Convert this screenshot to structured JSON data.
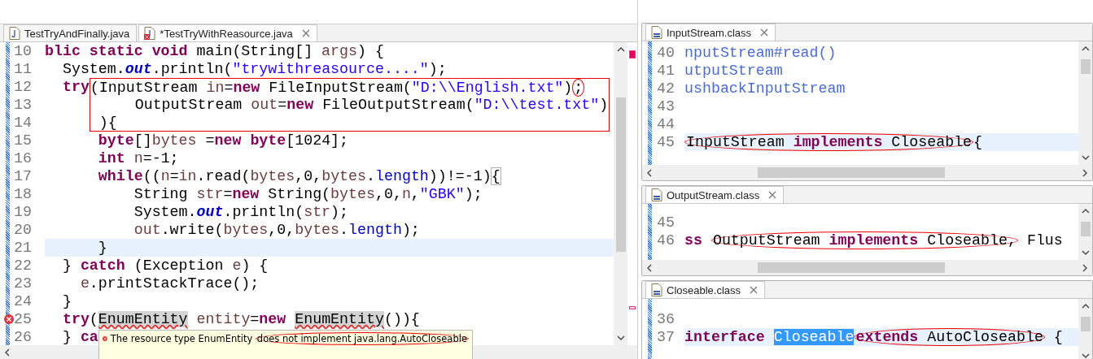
{
  "editor": {
    "tabs": [
      {
        "label": "TestTryAndFinally.java",
        "kind": "java",
        "selected": false,
        "error": false
      },
      {
        "label": "*TestTryWithReasource.java",
        "kind": "java",
        "selected": true,
        "error": true
      }
    ],
    "lines": [
      {
        "number": "10",
        "current": false,
        "error": false,
        "tokens": [
          {
            "text": "blic static void",
            "kind": "keyword"
          },
          {
            "text": " main(String[] ",
            "kind": "plain"
          },
          {
            "text": "args",
            "kind": "local"
          },
          {
            "text": ") {",
            "kind": "plain"
          }
        ]
      },
      {
        "number": "11",
        "current": false,
        "error": false,
        "tokens": [
          {
            "text": "  System.",
            "kind": "plain"
          },
          {
            "text": "out",
            "kind": "static-field"
          },
          {
            "text": ".println(",
            "kind": "plain"
          },
          {
            "text": "\"trywithreasource....\"",
            "kind": "string"
          },
          {
            "text": ");",
            "kind": "plain"
          }
        ]
      },
      {
        "number": "12",
        "current": false,
        "error": false,
        "tokens": [
          {
            "text": "  try",
            "kind": "keyword"
          },
          {
            "kind": "box",
            "top": true,
            "bottom": false,
            "tokens": [
              {
                "text": "(InputStream ",
                "kind": "plain"
              },
              {
                "text": "in",
                "kind": "local"
              },
              {
                "text": "=",
                "kind": "plain"
              },
              {
                "text": "new",
                "kind": "keyword"
              },
              {
                "text": " FileInputStream(",
                "kind": "plain"
              },
              {
                "text": "\"D:\\\\English.txt\"",
                "kind": "string"
              },
              {
                "text": ")",
                "kind": "plain"
              },
              {
                "kind": "circled",
                "tokens": [
                  {
                    "text": ";",
                    "kind": "plain"
                  }
                ]
              }
            ]
          }
        ]
      },
      {
        "number": "13",
        "current": false,
        "error": false,
        "tokens": [
          {
            "kind": "box",
            "top": false,
            "bottom": false,
            "tokens": [
              {
                "text": "     OutputStream ",
                "kind": "plain"
              },
              {
                "text": "out",
                "kind": "local"
              },
              {
                "text": "=",
                "kind": "plain"
              },
              {
                "text": "new",
                "kind": "keyword"
              },
              {
                "text": " FileOutputStream(",
                "kind": "plain"
              },
              {
                "text": "\"D:\\\\test.txt\"",
                "kind": "string"
              },
              {
                "text": ")",
                "kind": "plain"
              }
            ]
          }
        ]
      },
      {
        "number": "14",
        "current": false,
        "error": false,
        "tokens": [
          {
            "kind": "box",
            "top": false,
            "bottom": true,
            "tokens": [
              {
                "text": " ){",
                "kind": "plain"
              }
            ]
          }
        ]
      },
      {
        "number": "15",
        "current": false,
        "error": false,
        "tokens": [
          {
            "text": "      byte",
            "kind": "keyword"
          },
          {
            "text": "[]",
            "kind": "plain"
          },
          {
            "text": "bytes",
            "kind": "local"
          },
          {
            "text": " =",
            "kind": "plain"
          },
          {
            "text": "new",
            "kind": "keyword"
          },
          {
            "text": " byte",
            "kind": "keyword"
          },
          {
            "text": "[1024];",
            "kind": "plain"
          }
        ]
      },
      {
        "number": "16",
        "current": false,
        "error": false,
        "tokens": [
          {
            "text": "      int",
            "kind": "keyword"
          },
          {
            "text": " n",
            "kind": "local"
          },
          {
            "text": "=-1;",
            "kind": "plain"
          }
        ]
      },
      {
        "number": "17",
        "current": false,
        "error": false,
        "tokens": [
          {
            "text": "      while",
            "kind": "keyword"
          },
          {
            "text": "((",
            "kind": "plain"
          },
          {
            "text": "n",
            "kind": "local"
          },
          {
            "text": "=",
            "kind": "plain"
          },
          {
            "text": "in",
            "kind": "local"
          },
          {
            "text": ".read(",
            "kind": "plain"
          },
          {
            "text": "bytes",
            "kind": "local"
          },
          {
            "text": ",0,",
            "kind": "plain"
          },
          {
            "text": "bytes",
            "kind": "local"
          },
          {
            "text": ".",
            "kind": "plain"
          },
          {
            "text": "length",
            "kind": "field"
          },
          {
            "text": "))!=-1)",
            "kind": "plain"
          },
          {
            "kind": "bracket",
            "tokens": [
              {
                "text": "{",
                "kind": "plain"
              }
            ]
          }
        ]
      },
      {
        "number": "18",
        "current": false,
        "error": false,
        "tokens": [
          {
            "text": "          String ",
            "kind": "plain"
          },
          {
            "text": "str",
            "kind": "local"
          },
          {
            "text": "=",
            "kind": "plain"
          },
          {
            "text": "new",
            "kind": "keyword"
          },
          {
            "text": " String(",
            "kind": "plain"
          },
          {
            "text": "bytes",
            "kind": "local"
          },
          {
            "text": ",0,",
            "kind": "plain"
          },
          {
            "text": "n",
            "kind": "local"
          },
          {
            "text": ",",
            "kind": "plain"
          },
          {
            "text": "\"GBK\"",
            "kind": "string"
          },
          {
            "text": ");",
            "kind": "plain"
          }
        ]
      },
      {
        "number": "19",
        "current": false,
        "error": false,
        "tokens": [
          {
            "text": "          System.",
            "kind": "plain"
          },
          {
            "text": "out",
            "kind": "static-field"
          },
          {
            "text": ".println(",
            "kind": "plain"
          },
          {
            "text": "str",
            "kind": "local"
          },
          {
            "text": ");",
            "kind": "plain"
          }
        ]
      },
      {
        "number": "20",
        "current": false,
        "error": false,
        "tokens": [
          {
            "text": "          out",
            "kind": "local"
          },
          {
            "text": ".write(",
            "kind": "plain"
          },
          {
            "text": "bytes",
            "kind": "local"
          },
          {
            "text": ",0,",
            "kind": "plain"
          },
          {
            "text": "bytes",
            "kind": "local"
          },
          {
            "text": ".",
            "kind": "plain"
          },
          {
            "text": "length",
            "kind": "field"
          },
          {
            "text": ");",
            "kind": "plain"
          }
        ]
      },
      {
        "number": "21",
        "current": true,
        "error": false,
        "tokens": [
          {
            "text": "      }",
            "kind": "plain"
          }
        ]
      },
      {
        "number": "22",
        "current": false,
        "error": false,
        "tokens": [
          {
            "text": "  } ",
            "kind": "plain"
          },
          {
            "text": "catch",
            "kind": "keyword"
          },
          {
            "text": " (Exception ",
            "kind": "plain"
          },
          {
            "text": "e",
            "kind": "local"
          },
          {
            "text": ") {",
            "kind": "plain"
          }
        ]
      },
      {
        "number": "23",
        "current": false,
        "error": false,
        "tokens": [
          {
            "text": "    e",
            "kind": "local"
          },
          {
            "text": ".printStackTrace();",
            "kind": "plain"
          }
        ]
      },
      {
        "number": "24",
        "current": false,
        "error": false,
        "tokens": [
          {
            "text": "  }",
            "kind": "plain"
          }
        ]
      },
      {
        "number": "25",
        "current": false,
        "error": true,
        "tokens": [
          {
            "text": "  try",
            "kind": "keyword"
          },
          {
            "text": "(",
            "kind": "plain"
          },
          {
            "kind": "occurrence",
            "tokens": [
              {
                "text": "EnumEntity",
                "kind": "plain"
              }
            ]
          },
          {
            "text": " entity",
            "kind": "local"
          },
          {
            "text": "=",
            "kind": "plain"
          },
          {
            "text": "new ",
            "kind": "keyword"
          },
          {
            "kind": "occurrence",
            "tokens": [
              {
                "text": "EnumEntity",
                "kind": "plain"
              }
            ]
          },
          {
            "text": "()){",
            "kind": "plain"
          }
        ]
      },
      {
        "number": "26",
        "current": false,
        "error": false,
        "tokens": [
          {
            "text": "  } ",
            "kind": "plain"
          },
          {
            "text": "ca",
            "kind": "keyword"
          }
        ]
      }
    ],
    "error_popup": {
      "message": [
        {
          "text": "The resource type EnumEntity ",
          "kind": "plain"
        },
        {
          "kind": "circled",
          "tokens": [
            {
              "text": "does not implement java.lang.AutoCloseable",
              "kind": "plain"
            }
          ]
        }
      ]
    }
  },
  "class_panes": [
    {
      "tab": {
        "label": "InputStream.class",
        "kind": "class",
        "selected": true,
        "error": false
      },
      "lines": [
        {
          "number": "40",
          "current": false,
          "tokens": [
            {
              "text": "nputStream#read()",
              "kind": "doc"
            }
          ]
        },
        {
          "number": "41",
          "current": false,
          "tokens": [
            {
              "text": "utputStream",
              "kind": "doc"
            }
          ]
        },
        {
          "number": "42",
          "current": false,
          "tokens": [
            {
              "text": "ushbackInputStream",
              "kind": "doc"
            }
          ]
        },
        {
          "number": "43",
          "current": false
        },
        {
          "number": "44",
          "current": false
        },
        {
          "number": "45",
          "current": true,
          "tokens": [
            {
              "kind": "circled",
              "tokens": [
                {
                  "text": "InputStream ",
                  "kind": "plain"
                },
                {
                  "text": "implements",
                  "kind": "keyword"
                },
                {
                  "text": " Closeable",
                  "kind": "plain"
                }
              ]
            },
            {
              "text": "{",
              "kind": "plain"
            }
          ]
        }
      ]
    },
    {
      "tab": {
        "label": "OutputStream.class",
        "kind": "class",
        "selected": true,
        "error": false
      },
      "lines": [
        {
          "number": "45",
          "current": false
        },
        {
          "number": "46",
          "current": false,
          "tokens": [
            {
              "text": "ss ",
              "kind": "keyword"
            },
            {
              "kind": "circled",
              "tokens": [
                {
                  "text": "OutputStream ",
                  "kind": "plain"
                },
                {
                  "text": "implements",
                  "kind": "keyword"
                },
                {
                  "text": " Closeable,",
                  "kind": "plain"
                }
              ]
            },
            {
              "text": " Flus",
              "kind": "plain"
            }
          ]
        }
      ]
    },
    {
      "tab": {
        "label": "Closeable.class",
        "kind": "class",
        "selected": true,
        "error": false
      },
      "lines": [
        {
          "number": "36",
          "current": false
        },
        {
          "number": "37",
          "current": true,
          "tokens": [
            {
              "text": "interface ",
              "kind": "keyword"
            },
            {
              "kind": "selected",
              "tokens": [
                {
                  "text": "Closeable",
                  "kind": "plain"
                }
              ]
            },
            {
              "kind": "circled",
              "tokens": [
                {
                  "text": "extends",
                  "kind": "keyword"
                },
                {
                  "text": " AutoCloseable",
                  "kind": "plain"
                }
              ]
            },
            {
              "text": " {",
              "kind": "plain"
            }
          ]
        }
      ]
    }
  ]
}
